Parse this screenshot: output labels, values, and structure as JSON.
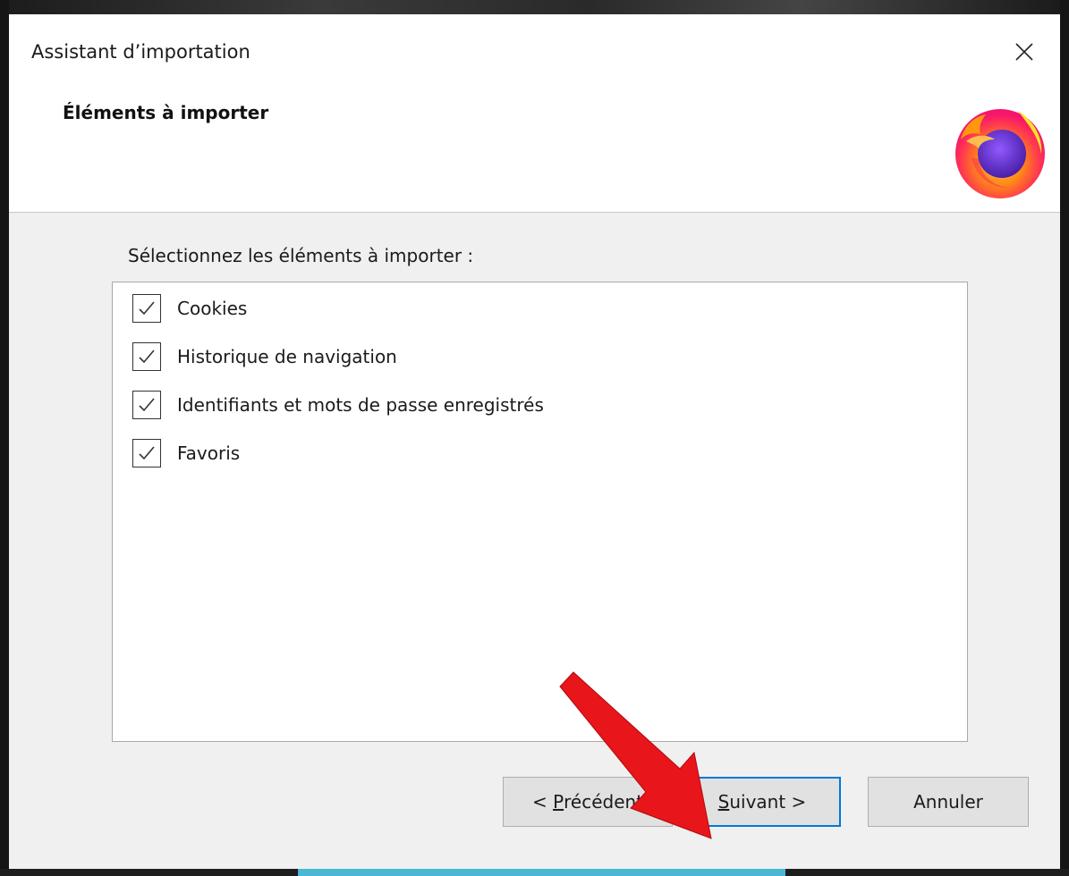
{
  "window": {
    "title": "Assistant d’importation"
  },
  "header": {
    "heading": "Éléments à importer",
    "logo_icon": "firefox-logo"
  },
  "main": {
    "instruction": "Sélectionnez les éléments à importer :",
    "items": [
      {
        "label": "Cookies",
        "checked": true
      },
      {
        "label": "Historique de navigation",
        "checked": true
      },
      {
        "label": "Identifiants et mots de passe enregistrés",
        "checked": true
      },
      {
        "label": "Favoris",
        "checked": true
      }
    ]
  },
  "buttons": {
    "previous": {
      "prefix": "< ",
      "mnemonic": "P",
      "rest": "récédent"
    },
    "next": {
      "mnemonic": "S",
      "rest": "uivant >"
    },
    "cancel": "Annuler"
  },
  "colors": {
    "focus_border": "#0078d7",
    "annotation_arrow": "#e8151b"
  }
}
